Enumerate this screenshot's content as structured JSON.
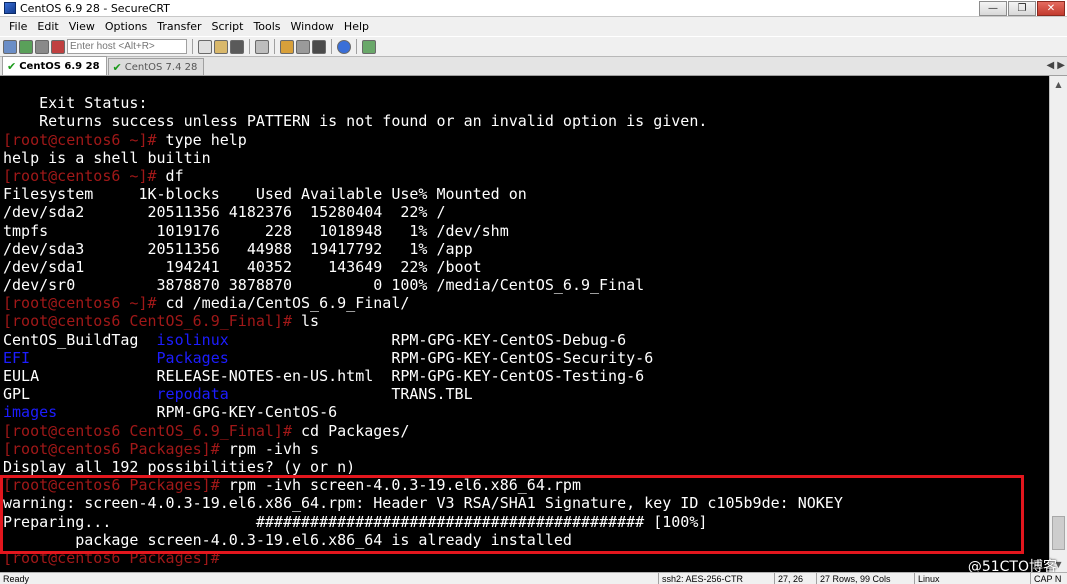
{
  "window": {
    "title": "CentOS 6.9 28 - SecureCRT"
  },
  "menu": [
    "File",
    "Edit",
    "View",
    "Options",
    "Transfer",
    "Script",
    "Tools",
    "Window",
    "Help"
  ],
  "toolbar": {
    "host_placeholder": "Enter host <Alt+R>"
  },
  "tabs": [
    {
      "label": "CentOS 6.9 28",
      "active": true
    },
    {
      "label": "CentOS 7.4 28",
      "active": false
    }
  ],
  "terminal": {
    "lines": [
      [
        {
          "t": ""
        }
      ],
      [
        {
          "t": "    Exit Status:"
        }
      ],
      [
        {
          "t": "    Returns success unless PATTERN is not found or an invalid option is given."
        }
      ],
      [
        {
          "t": "[root@centos6 ~]#",
          "c": "prompt"
        },
        {
          "t": " type help"
        }
      ],
      [
        {
          "t": "help is a shell builtin"
        }
      ],
      [
        {
          "t": "[root@centos6 ~]#",
          "c": "prompt"
        },
        {
          "t": " df"
        }
      ],
      [
        {
          "t": "Filesystem     1K-blocks    Used Available Use% Mounted on"
        }
      ],
      [
        {
          "t": "/dev/sda2       20511356 4182376  15280404  22% /"
        }
      ],
      [
        {
          "t": "tmpfs            1019176     228   1018948   1% /dev/shm"
        }
      ],
      [
        {
          "t": "/dev/sda3       20511356   44988  19417792   1% /app"
        }
      ],
      [
        {
          "t": "/dev/sda1         194241   40352    143649  22% /boot"
        }
      ],
      [
        {
          "t": "/dev/sr0         3878870 3878870         0 100% /media/CentOS_6.9_Final"
        }
      ],
      [
        {
          "t": "[root@centos6 ~]#",
          "c": "prompt"
        },
        {
          "t": " cd /media/CentOS_6.9_Final/"
        }
      ],
      [
        {
          "t": "[root@centos6 CentOS_6.9_Final]#",
          "c": "prompt"
        },
        {
          "t": " ls"
        }
      ],
      [
        {
          "t": "CentOS_BuildTag  "
        },
        {
          "t": "isolinux",
          "c": "blue"
        },
        {
          "t": "                  RPM-GPG-KEY-CentOS-Debug-6"
        }
      ],
      [
        {
          "t": "EFI",
          "c": "blue"
        },
        {
          "t": "              "
        },
        {
          "t": "Packages",
          "c": "blue"
        },
        {
          "t": "                  RPM-GPG-KEY-CentOS-Security-6"
        }
      ],
      [
        {
          "t": "EULA             RELEASE-NOTES-en-US.html  RPM-GPG-KEY-CentOS-Testing-6"
        }
      ],
      [
        {
          "t": "GPL              "
        },
        {
          "t": "repodata",
          "c": "blue"
        },
        {
          "t": "                  TRANS.TBL"
        }
      ],
      [
        {
          "t": "images",
          "c": "blue"
        },
        {
          "t": "           RPM-GPG-KEY-CentOS-6"
        }
      ],
      [
        {
          "t": "[root@centos6 CentOS_6.9_Final]#",
          "c": "prompt"
        },
        {
          "t": " cd Packages/"
        }
      ],
      [
        {
          "t": "[root@centos6 Packages]#",
          "c": "prompt"
        },
        {
          "t": " rpm -ivh s"
        }
      ],
      [
        {
          "t": "Display all 192 possibilities? (y or n)"
        }
      ],
      [
        {
          "t": "[root@centos6 Packages]#",
          "c": "prompt"
        },
        {
          "t": " rpm -ivh screen-4.0.3-19.el6.x86_64.rpm"
        }
      ],
      [
        {
          "t": "warning: screen-4.0.3-19.el6.x86_64.rpm: Header V3 RSA/SHA1 Signature, key ID c105b9de: NOKEY"
        }
      ],
      [
        {
          "t": "Preparing...                ########################################### [100%]"
        }
      ],
      [
        {
          "t": "        package screen-4.0.3-19.el6.x86_64 is already installed"
        }
      ],
      [
        {
          "t": "[root@centos6 Packages]#",
          "c": "prompt"
        }
      ]
    ]
  },
  "status": {
    "ready": "Ready",
    "cipher": "ssh2: AES-256-CTR",
    "cursor": "27, 26",
    "size": "27 Rows, 99 Cols",
    "os": "Linux",
    "caps": "CAP N"
  },
  "watermark": "@51CTO博客",
  "colors": {
    "prompt": "#a01818",
    "blue_dir": "#1d1dff",
    "annotation": "#e3161d"
  }
}
